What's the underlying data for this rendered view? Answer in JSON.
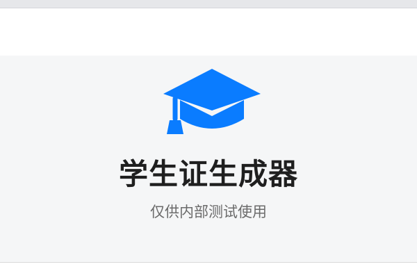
{
  "hero": {
    "icon": "graduation-cap-icon",
    "title": "学生证生成器",
    "subtitle": "仅供内部测试使用"
  },
  "colors": {
    "accent": "#0a7cff",
    "title": "#1f1f1f",
    "subtitle": "#6b6b6b",
    "hero_background": "#f5f6f7"
  }
}
